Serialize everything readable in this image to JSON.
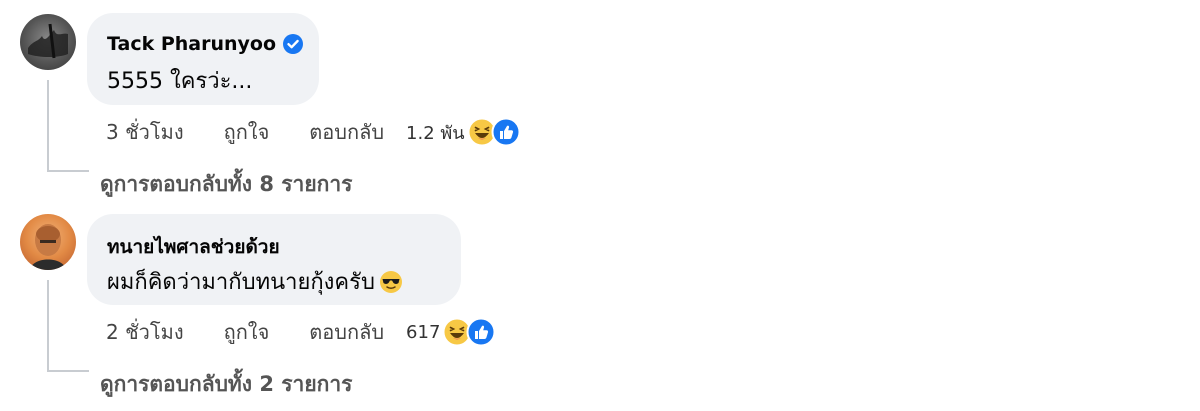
{
  "comments": [
    {
      "author": "Tack Pharunyoo",
      "verified": true,
      "text": "5555 ใครว่ะ...",
      "time": "3 ชั่วโมง",
      "like": "ถูกใจ",
      "reply": "ตอบกลับ",
      "reaction_count": "1.2 พัน",
      "reactions": [
        "haha-icon",
        "like-icon"
      ],
      "view_replies": "ดูการตอบกลับทั้ง 8 รายการ"
    },
    {
      "author": "ทนายไพศาลช่วยด้วย",
      "verified": false,
      "text": "ผมก็คิดว่ามากับทนายกุ้งครับ",
      "text_emoji": "sunglasses-emoji-icon",
      "time": "2 ชั่วโมง",
      "like": "ถูกใจ",
      "reply": "ตอบกลับ",
      "reaction_count": "617",
      "reactions": [
        "haha-icon",
        "like-icon"
      ],
      "view_replies": "ดูการตอบกลับทั้ง 2 รายการ"
    }
  ],
  "colors": {
    "bubble": "#f0f2f5",
    "verified_blue": "#1877f2",
    "like_blue": "#1877f2",
    "haha_yellow": "#f7c845",
    "meta_gray": "#65676b"
  }
}
